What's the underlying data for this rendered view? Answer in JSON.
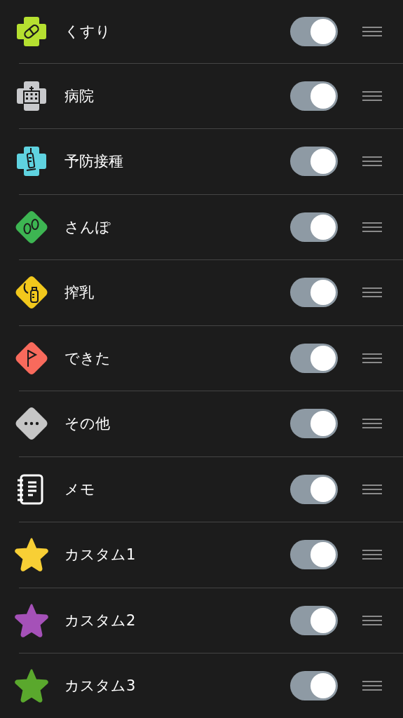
{
  "items": [
    {
      "label": "くすり",
      "kind": "pill",
      "color": "#b5e030",
      "on": true
    },
    {
      "label": "病院",
      "kind": "hospital",
      "color": "#c8c9cc",
      "on": true
    },
    {
      "label": "予防接種",
      "kind": "syringe",
      "color": "#5fd3e0",
      "on": true
    },
    {
      "label": "さんぽ",
      "kind": "footprints",
      "color": "#3db552",
      "on": true
    },
    {
      "label": "搾乳",
      "kind": "pump",
      "color": "#f2c81c",
      "on": true
    },
    {
      "label": "できた",
      "kind": "flag",
      "color": "#f86a5c",
      "on": true
    },
    {
      "label": "その他",
      "kind": "more",
      "color": "#c6c6c6",
      "on": true
    },
    {
      "label": "メモ",
      "kind": "memo",
      "color": "#ffffff",
      "on": true
    },
    {
      "label": "カスタム1",
      "kind": "star",
      "color": "#f8cf35",
      "on": true
    },
    {
      "label": "カスタム2",
      "kind": "star",
      "color": "#a551b8",
      "on": true
    },
    {
      "label": "カスタム3",
      "kind": "star",
      "color": "#5aa82d",
      "on": true
    }
  ]
}
